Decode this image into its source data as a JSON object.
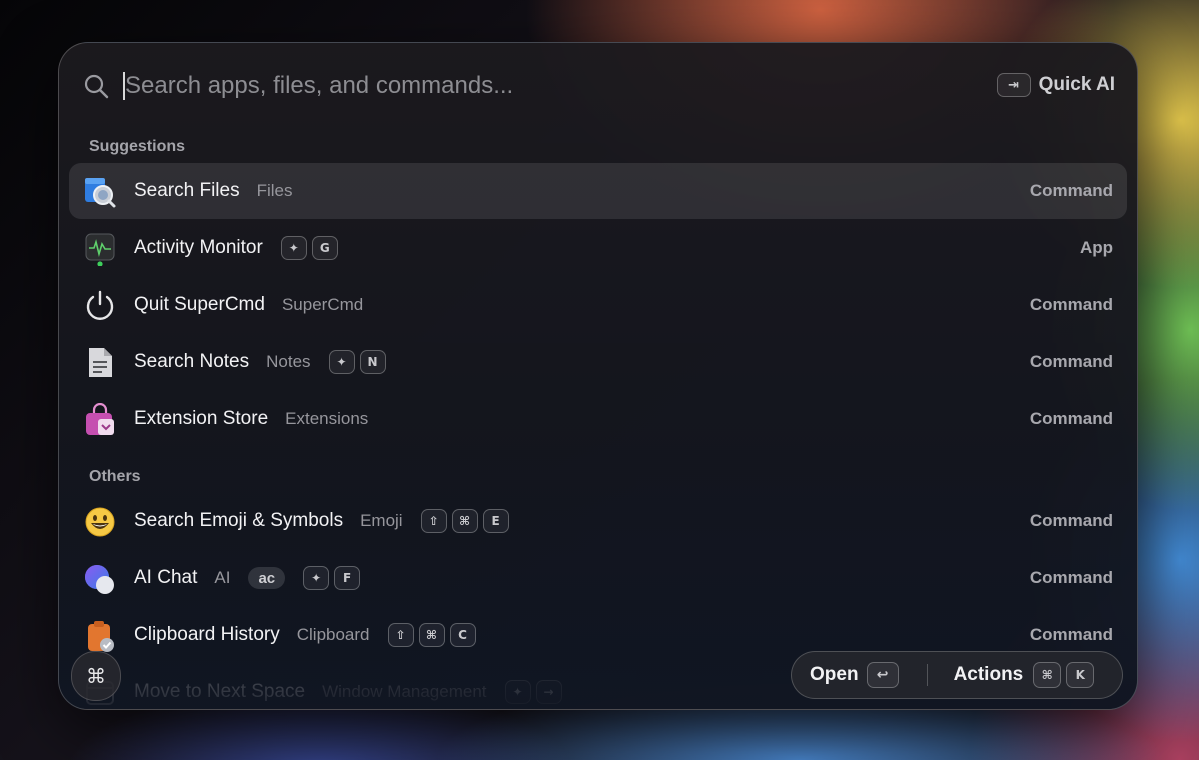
{
  "search": {
    "placeholder": "Search apps, files, and commands...",
    "value": "",
    "quick_ai_key": "⇥",
    "quick_ai_label": "Quick AI"
  },
  "sections": {
    "suggestions": "Suggestions",
    "others": "Others"
  },
  "suggestions": [
    {
      "title": "Search Files",
      "subtitle": "Files",
      "keys": [],
      "type": "Command",
      "icon": "search-files-icon"
    },
    {
      "title": "Activity Monitor",
      "subtitle": "",
      "keys": [
        "✦",
        "G"
      ],
      "type": "App",
      "icon": "activity-monitor-icon"
    },
    {
      "title": "Quit SuperCmd",
      "subtitle": "SuperCmd",
      "keys": [],
      "type": "Command",
      "icon": "power-icon"
    },
    {
      "title": "Search Notes",
      "subtitle": "Notes",
      "keys": [
        "✦",
        "N"
      ],
      "type": "Command",
      "icon": "notes-icon"
    },
    {
      "title": "Extension Store",
      "subtitle": "Extensions",
      "keys": [],
      "type": "Command",
      "icon": "store-bag-icon"
    }
  ],
  "others": [
    {
      "title": "Search Emoji & Symbols",
      "subtitle": "Emoji",
      "alias": "",
      "keys": [
        "⇧",
        "⌘",
        "E"
      ],
      "type": "Command",
      "icon": "emoji-icon"
    },
    {
      "title": "AI Chat",
      "subtitle": "AI",
      "alias": "ac",
      "keys": [
        "✦",
        "F"
      ],
      "type": "Command",
      "icon": "ai-chat-icon"
    },
    {
      "title": "Clipboard History",
      "subtitle": "Clipboard",
      "alias": "",
      "keys": [
        "⇧",
        "⌘",
        "C"
      ],
      "type": "Command",
      "icon": "clipboard-icon"
    },
    {
      "title": "Move to Next Space",
      "subtitle": "Window Management",
      "alias": "",
      "keys": [
        "✦",
        "→"
      ],
      "type": "",
      "icon": "window-icon"
    }
  ],
  "footer": {
    "command_glyph": "⌘",
    "open_label": "Open",
    "open_key": "↩",
    "actions_label": "Actions",
    "actions_keys": [
      "⌘",
      "K"
    ]
  },
  "colors": {
    "selected_row": "#2c2c32",
    "text_primary": "#f2f2f4",
    "text_secondary": "#96969c",
    "accent_green": "#3ecf5c"
  }
}
